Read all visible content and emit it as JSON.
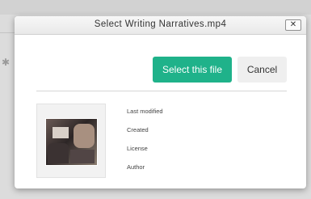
{
  "dialog": {
    "title": "Select Writing Narratives.mp4",
    "close_label": "✕",
    "primary_label": "Select this file",
    "cancel_label": "Cancel"
  },
  "file_details": {
    "fields": [
      "Last modified",
      "Created",
      "License",
      "Author"
    ]
  },
  "colors": {
    "primary": "#1fb28a",
    "cancel_bg": "#efefef"
  }
}
